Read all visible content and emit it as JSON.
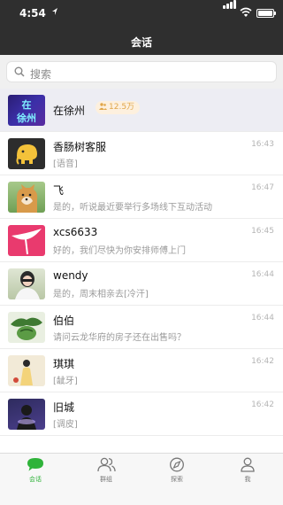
{
  "status_bar": {
    "time": "4:54"
  },
  "nav": {
    "title": "会话"
  },
  "search": {
    "placeholder": "搜索"
  },
  "chats": [
    {
      "name": "在徐州",
      "badge": "12.5万",
      "preview": "",
      "time": "",
      "pinned": true,
      "avatar": "avatar-zaixuzhou"
    },
    {
      "name": "香肠树客服",
      "preview": "[语音]",
      "time": "16:43",
      "avatar": "avatar-elephant"
    },
    {
      "name": "飞",
      "preview": "是的，听说最近要举行多场线下互动活动",
      "time": "16:47",
      "avatar": "avatar-dog"
    },
    {
      "name": "xcs6633",
      "preview": "好的，我们尽快为你安排师傅上门",
      "time": "16:45",
      "avatar": "avatar-pink"
    },
    {
      "name": "wendy",
      "preview": "是的，周末相亲去[冷汗]",
      "time": "16:44",
      "avatar": "avatar-wendy"
    },
    {
      "name": "伯伯",
      "preview": "请问云龙华府的房子还在出售吗？",
      "time": "16:44",
      "avatar": "avatar-bobo"
    },
    {
      "name": "琪琪",
      "preview": "[龇牙]",
      "time": "16:42",
      "avatar": "avatar-qiqi"
    },
    {
      "name": "旧城",
      "preview": "[调皮]",
      "time": "16:42",
      "avatar": "avatar-jiucheng"
    }
  ],
  "tabs": [
    {
      "label": "会话",
      "active": true
    },
    {
      "label": "群组"
    },
    {
      "label": "探索"
    },
    {
      "label": "我"
    }
  ],
  "colors": {
    "header_bg": "#2f2f2f",
    "accent": "#2fb33a",
    "badge_bg": "#fdf0de",
    "badge_text": "#e0a64a"
  },
  "icons": [
    "location-arrow-icon",
    "signal-icon",
    "wifi-icon",
    "battery-icon",
    "search-icon",
    "members-icon",
    "chat-bubble-icon",
    "group-icon",
    "compass-icon",
    "person-icon"
  ]
}
